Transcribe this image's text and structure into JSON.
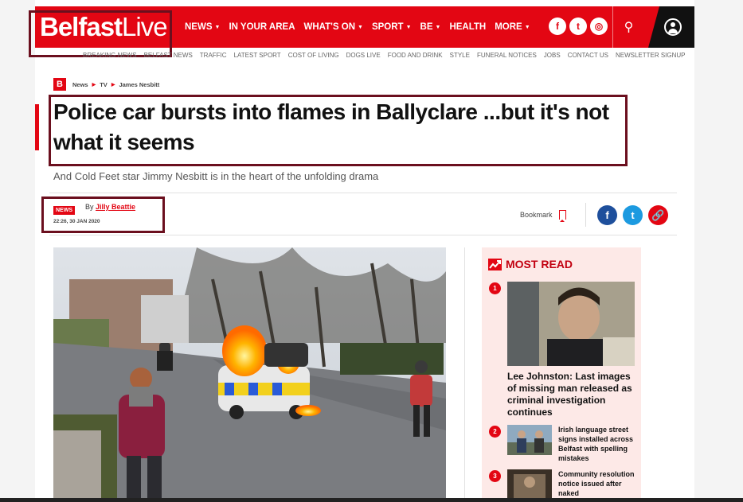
{
  "brand": {
    "name_bold": "Belfast",
    "name_light": "Live",
    "accent": "#e30613",
    "dark": "#111111"
  },
  "nav": {
    "items": [
      {
        "label": "NEWS",
        "has_menu": true
      },
      {
        "label": "IN YOUR AREA",
        "has_menu": false
      },
      {
        "label": "WHAT'S ON",
        "has_menu": true
      },
      {
        "label": "SPORT",
        "has_menu": true
      },
      {
        "label": "BE",
        "has_menu": true
      },
      {
        "label": "HEALTH",
        "has_menu": false
      },
      {
        "label": "MORE",
        "has_menu": true
      }
    ],
    "caret": "▼",
    "socials": [
      {
        "icon": "facebook-icon",
        "glyph": "f"
      },
      {
        "icon": "twitter-icon",
        "glyph": "t"
      },
      {
        "icon": "instagram-icon",
        "glyph": "◎"
      }
    ],
    "search_glyph": "⚲"
  },
  "subnav": [
    "BREAKING NEWS",
    "BELFAST NEWS",
    "TRAFFIC",
    "LATEST SPORT",
    "COST OF LIVING",
    "DOGS LIVE",
    "FOOD AND DRINK",
    "STYLE",
    "FUNERAL NOTICES",
    "JOBS",
    "CONTACT US",
    "NEWSLETTER SIGNUP"
  ],
  "breadcrumb": {
    "logo": "B",
    "items": [
      "News",
      "TV",
      "James Nesbitt"
    ],
    "sep": "▶"
  },
  "article": {
    "headline": "Police car bursts into flames in Ballyclare ...but it's not what it seems",
    "standfirst": "And Cold Feet star Jimmy Nesbitt is in the heart of the unfolding drama",
    "badge": "NEWS",
    "by_prefix": "By",
    "author": "Jilly Beattie",
    "date": "22:26, 30 JAN 2020",
    "bookmark_label": "Bookmark",
    "share": [
      {
        "icon": "facebook-share-icon",
        "glyph": "f",
        "color": "#1e4f9c"
      },
      {
        "icon": "twitter-share-icon",
        "glyph": "t",
        "color": "#1c9ae0"
      },
      {
        "icon": "copy-link-icon",
        "glyph": "🔗",
        "color": "#e30613"
      }
    ]
  },
  "most_read": {
    "title": "MOST READ",
    "items": [
      {
        "rank": "1",
        "title": "Lee Johnston: Last images of missing man released as criminal investigation continues"
      },
      {
        "rank": "2",
        "title": "Irish language street signs installed across Belfast with spelling mistakes"
      },
      {
        "rank": "3",
        "title": "Community resolution notice issued after naked"
      }
    ]
  }
}
